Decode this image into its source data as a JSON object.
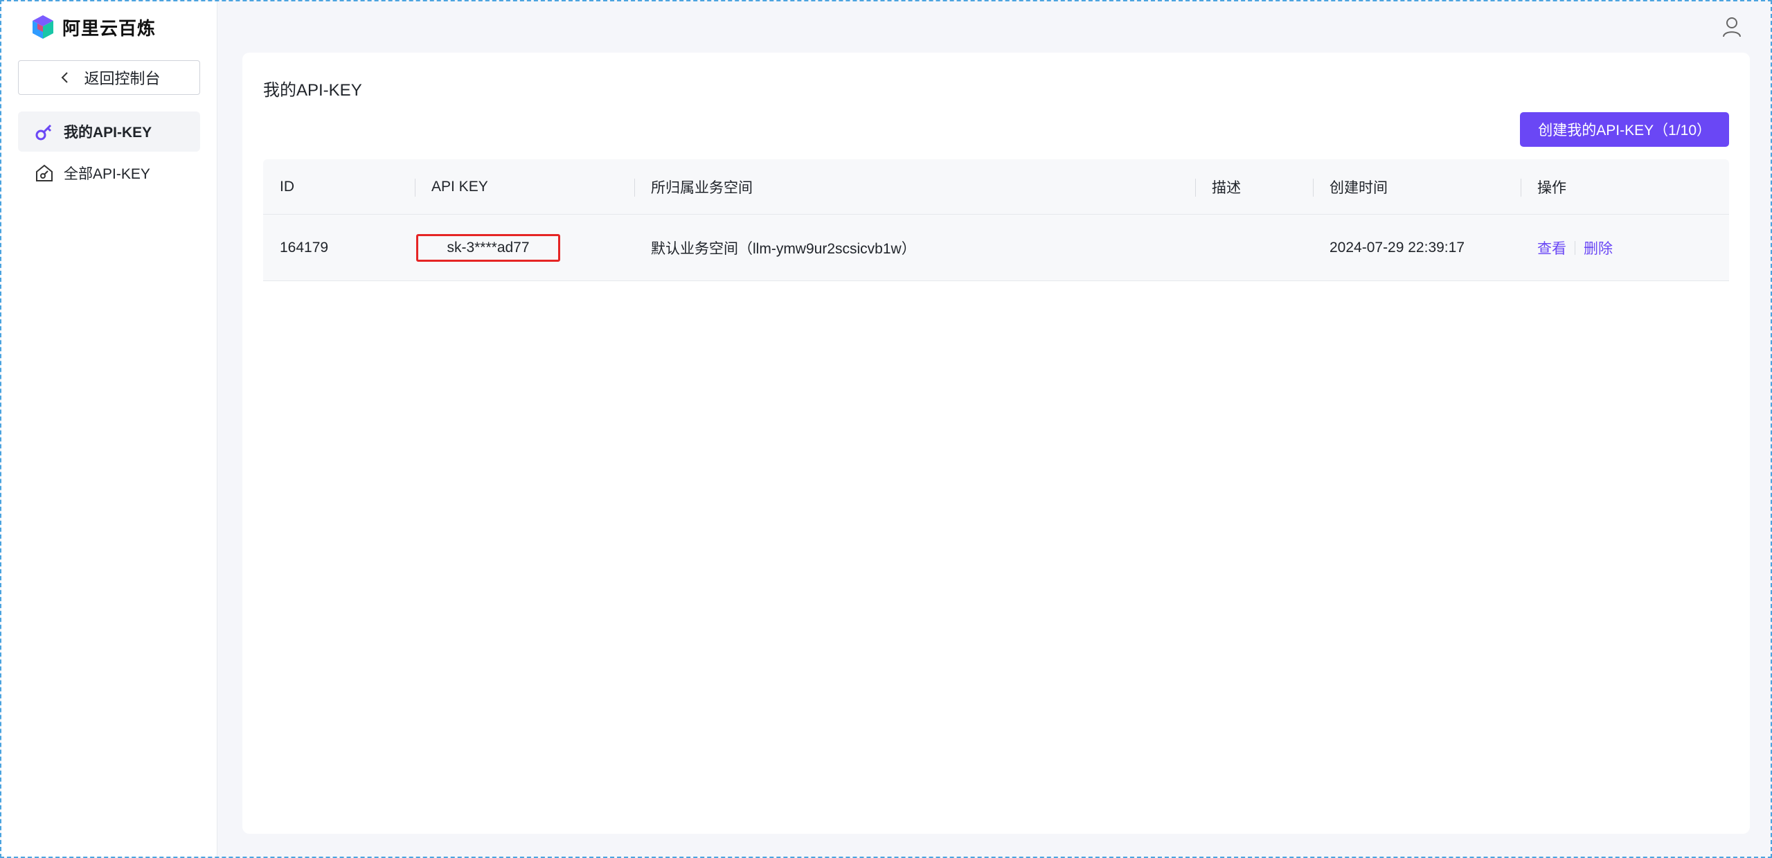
{
  "brand": {
    "name": "阿里云百炼",
    "colors": {
      "accent": "#6a47f5",
      "highlight": "#e52525"
    }
  },
  "sidebar": {
    "back_label": "返回控制台",
    "items": [
      {
        "label": "我的API-KEY",
        "icon": "key-icon",
        "active": true
      },
      {
        "label": "全部API-KEY",
        "icon": "house-key-icon",
        "active": false
      }
    ]
  },
  "header": {
    "user_icon": "user-icon"
  },
  "main": {
    "title": "我的API-KEY",
    "create_button": "创建我的API-KEY（1/10）",
    "table": {
      "columns": [
        "ID",
        "API KEY",
        "所归属业务空间",
        "描述",
        "创建时间",
        "操作"
      ],
      "rows": [
        {
          "id": "164179",
          "api_key": "sk-3****ad77",
          "workspace": "默认业务空间（llm-ymw9ur2scsicvb1w）",
          "description": "",
          "created": "2024-07-29 22:39:17",
          "actions": [
            "查看",
            "删除"
          ]
        }
      ]
    }
  }
}
